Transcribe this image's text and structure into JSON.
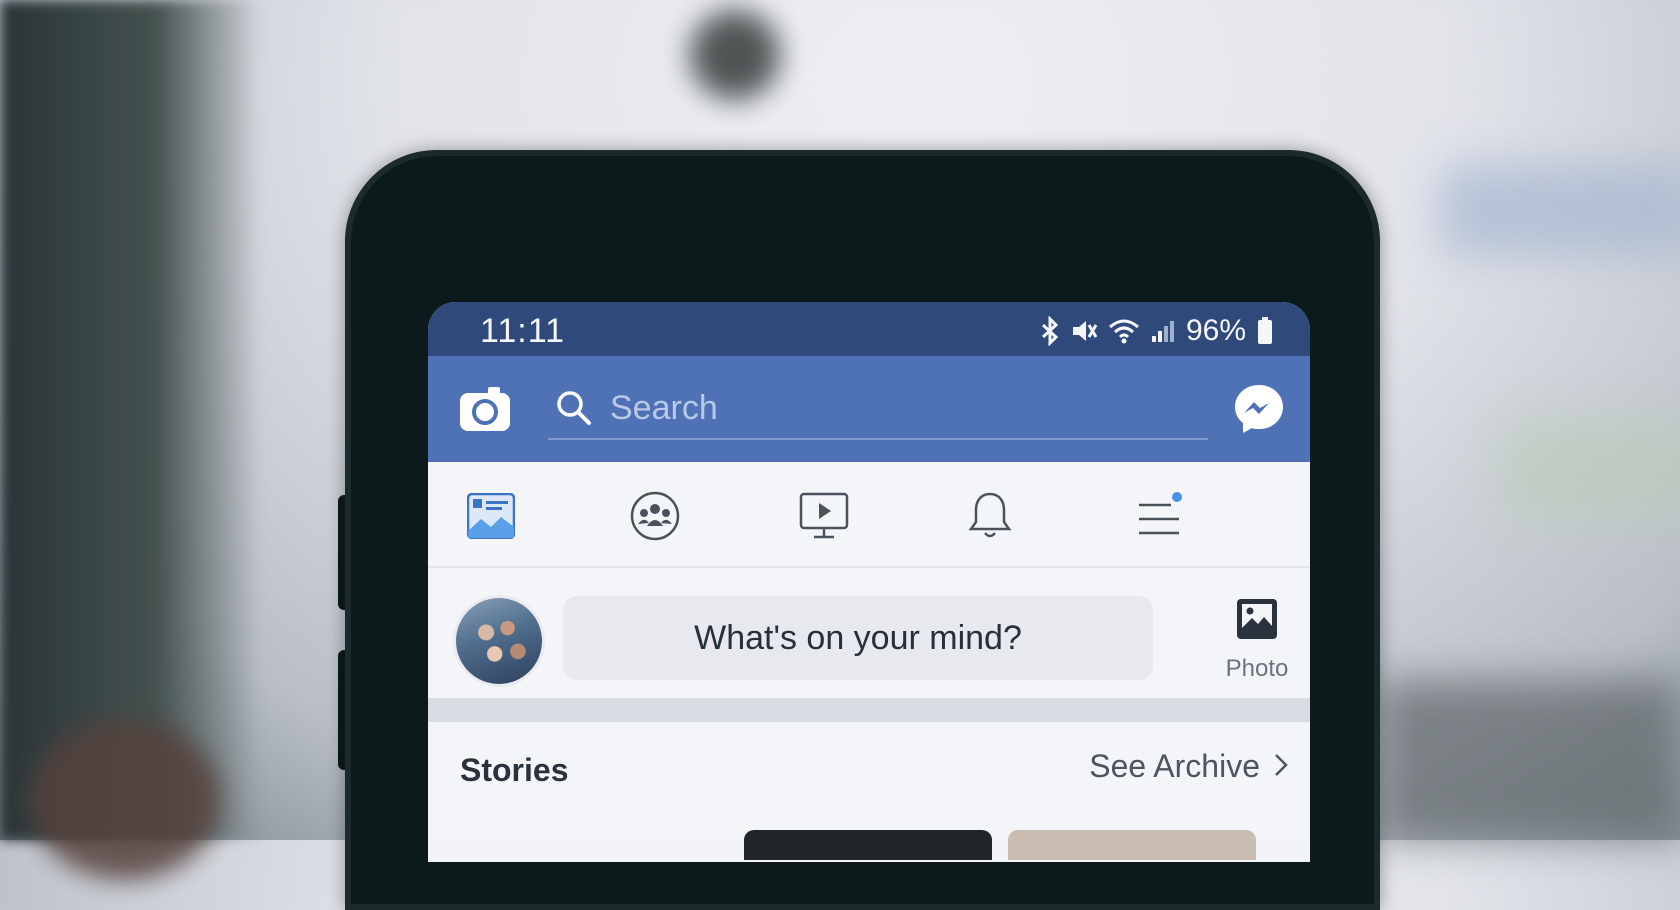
{
  "status_bar": {
    "time": "11:11",
    "battery": "96%"
  },
  "header": {
    "search_placeholder": "Search"
  },
  "composer": {
    "prompt": "What's on your mind?",
    "photo_label": "Photo"
  },
  "stories": {
    "title": "Stories",
    "archive_label": "See Archive"
  },
  "colors": {
    "status_bar": "#2f4a7a",
    "header": "#4f72b6",
    "accent_blue": "#4a90e2"
  },
  "icons": [
    "camera-icon",
    "search-icon",
    "messenger-icon",
    "news-feed-icon",
    "groups-icon",
    "watch-icon",
    "notifications-icon",
    "menu-icon",
    "photo-icon",
    "chevron-right-icon"
  ]
}
